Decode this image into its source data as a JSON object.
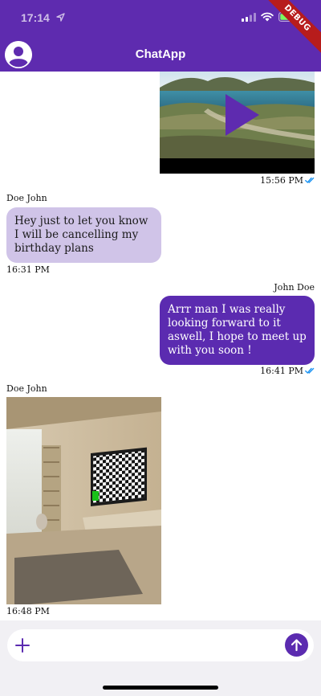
{
  "status_bar": {
    "time": "17:14"
  },
  "debug_banner": "DEBUG",
  "header": {
    "title": "ChatApp"
  },
  "messages": [
    {
      "type": "video",
      "time": "15:56 PM",
      "direction": "out",
      "read": true
    },
    {
      "type": "text",
      "sender": "Doe John",
      "text": "Hey just to let you know I will be cancelling my birthday plans",
      "time": "16:31 PM",
      "direction": "in"
    },
    {
      "type": "text",
      "sender": "John Doe",
      "text": "Arrr man I was really looking forward to it aswell, I hope to meet up with you soon !",
      "time": "16:41 PM",
      "direction": "out",
      "read": true
    },
    {
      "type": "image",
      "sender": "Doe John",
      "time": "16:48 PM",
      "direction": "in"
    }
  ],
  "colors": {
    "primary": "#5E2BAF",
    "incoming_bubble": "#D0C4E8",
    "outgoing_bubble": "#5B2BB0",
    "read_tick": "#2196F3"
  },
  "icons": [
    "location-arrow-icon",
    "signal-icon",
    "wifi-icon",
    "battery-icon",
    "account-circle-icon",
    "play-icon",
    "double-check-icon",
    "add-icon",
    "arrow-up-icon"
  ]
}
